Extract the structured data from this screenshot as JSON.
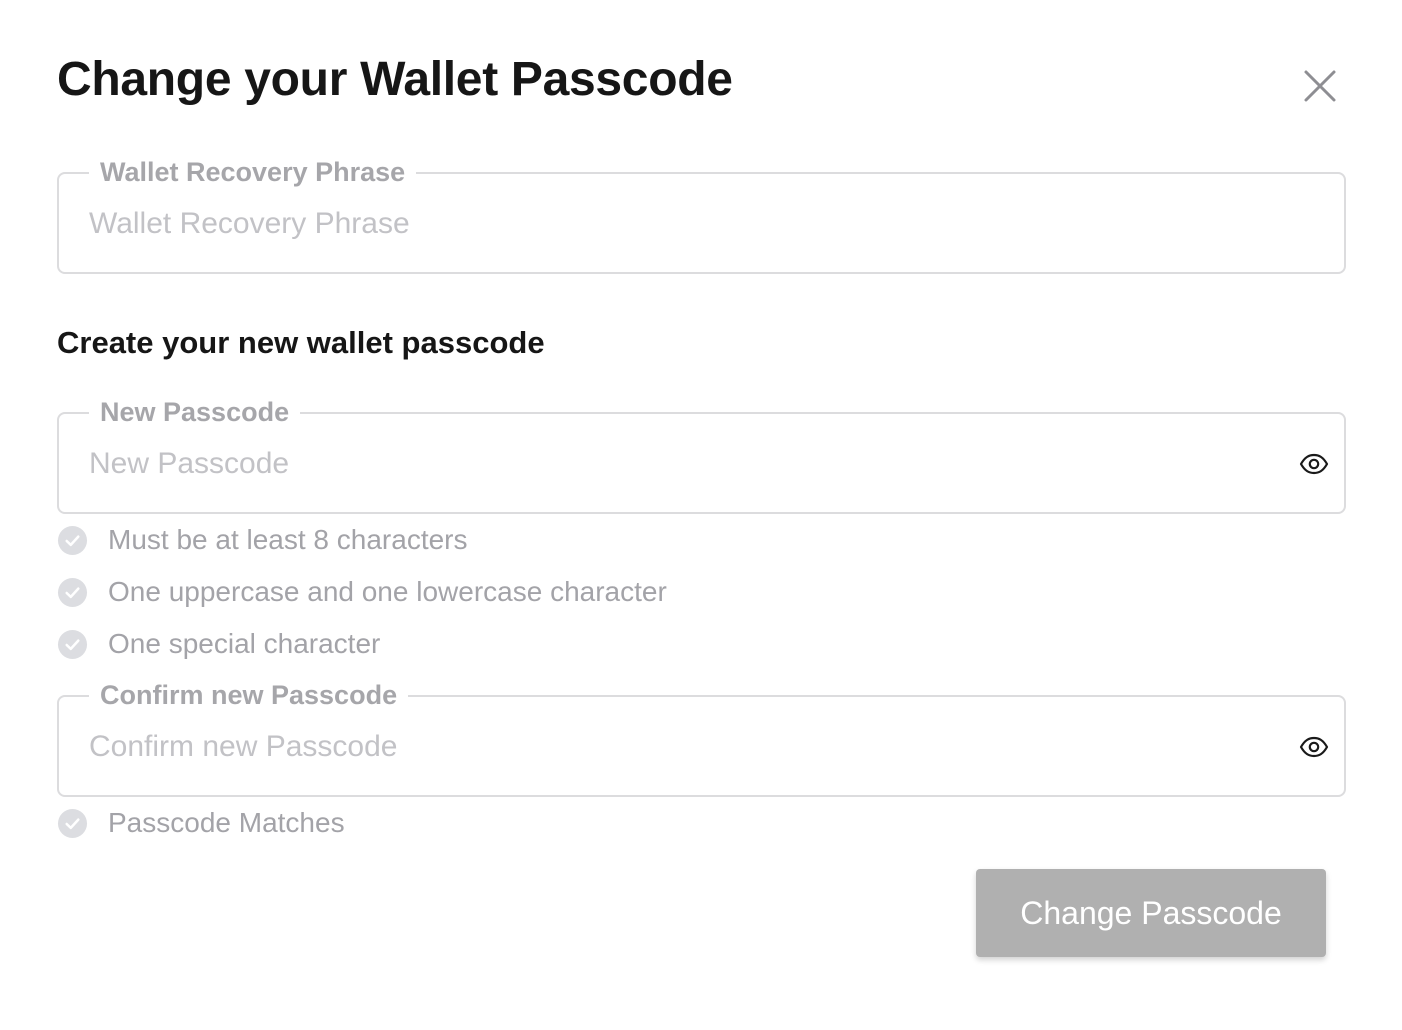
{
  "modal": {
    "title": "Change your Wallet Passcode",
    "close_icon": "close-icon"
  },
  "recovery_field": {
    "label": "Wallet Recovery Phrase",
    "placeholder": "Wallet Recovery Phrase",
    "value": ""
  },
  "section_heading": "Create your new wallet passcode",
  "new_passcode_field": {
    "label": "New Passcode",
    "placeholder": "New Passcode",
    "value": "",
    "toggle_icon": "eye-icon"
  },
  "requirements": [
    {
      "text": "Must be at least 8 characters",
      "icon": "check-circle-icon",
      "met": false
    },
    {
      "text": "One uppercase and one lowercase character",
      "icon": "check-circle-icon",
      "met": false
    },
    {
      "text": "One special character",
      "icon": "check-circle-icon",
      "met": false
    }
  ],
  "confirm_passcode_field": {
    "label": "Confirm new Passcode",
    "placeholder": "Confirm new Passcode",
    "value": "",
    "toggle_icon": "eye-icon"
  },
  "match_requirement": {
    "text": "Passcode Matches",
    "icon": "check-circle-icon",
    "met": false
  },
  "submit": {
    "label": "Change Passcode",
    "disabled": true
  },
  "colors": {
    "title": "#161616",
    "border": "#dcdcde",
    "label": "#a6a6aa",
    "placeholder": "#c2c2c6",
    "hint_text": "#a3a3a8",
    "check_icon_bg": "#dcdde1",
    "button_disabled_bg": "#b0b0b0",
    "button_text": "#ffffff"
  }
}
